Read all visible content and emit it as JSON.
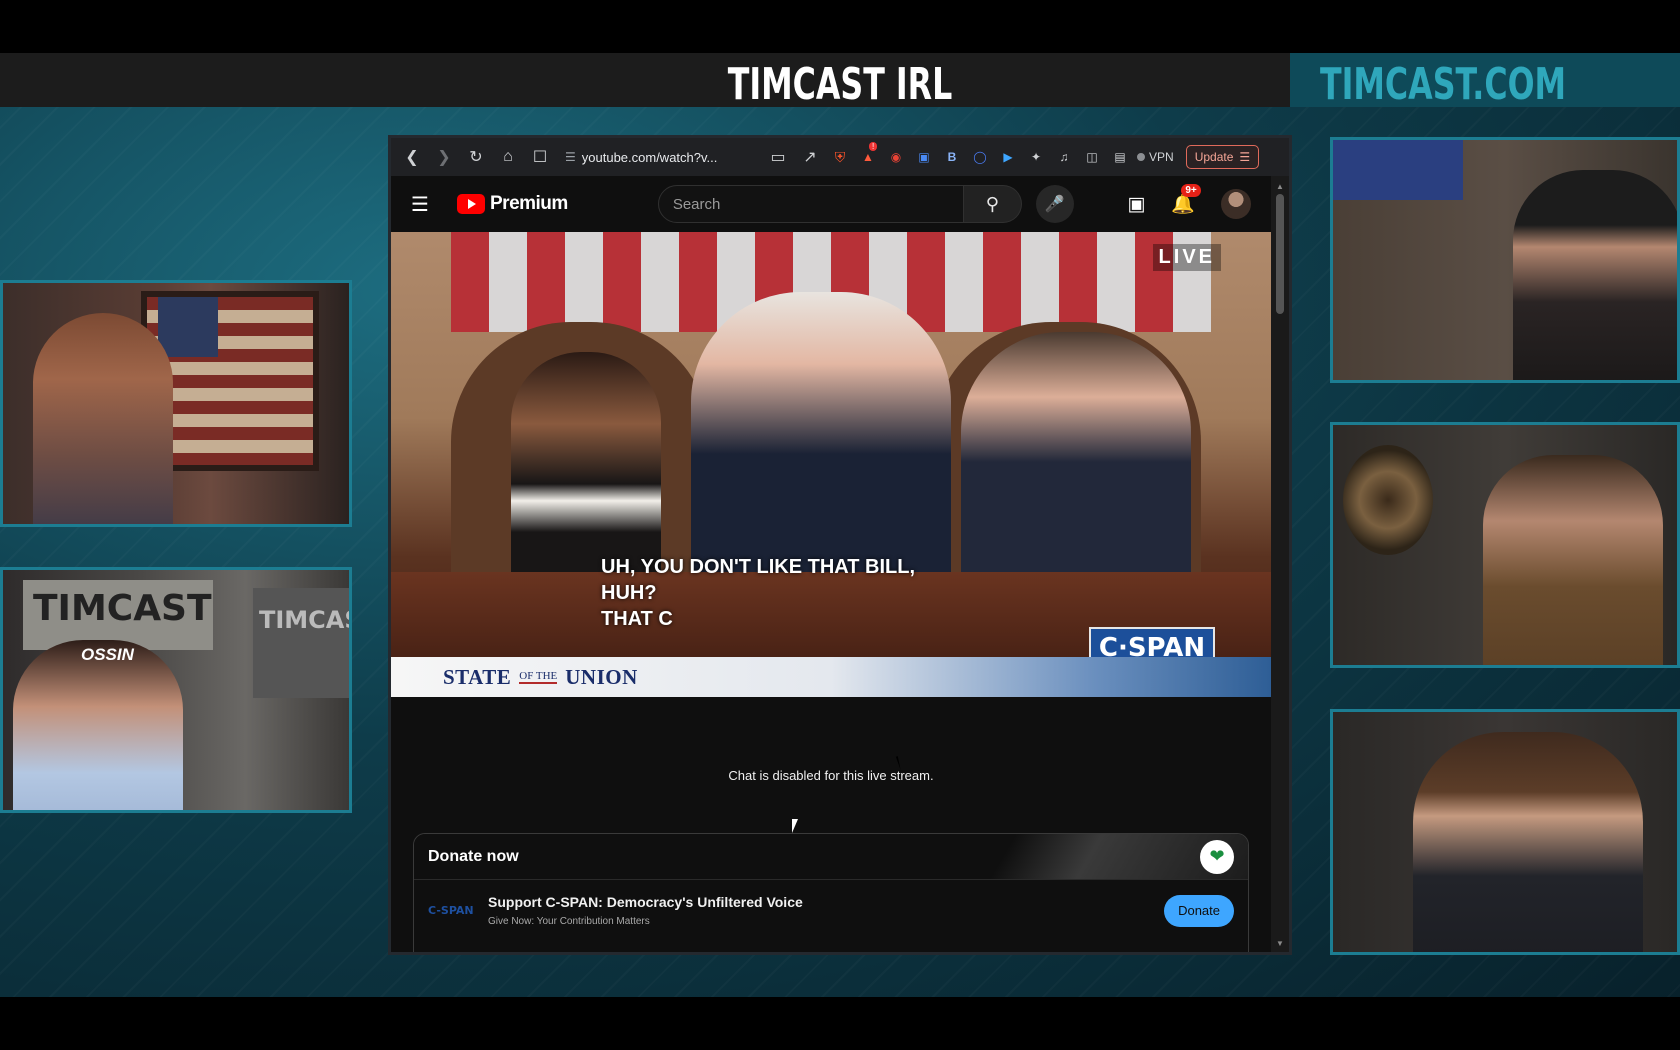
{
  "show": {
    "title": "TIMCAST IRL",
    "website": "TIMCAST.COM"
  },
  "cams": {
    "cam2_sign": "TIMCAST",
    "cam2_sign2": "TIMCAS",
    "cam2_chair_brand": "OSSIN"
  },
  "browser": {
    "url": "youtube.com/watch?v...",
    "vpn_label": "VPN",
    "update_label": "Update",
    "ext_badge": "!"
  },
  "youtube": {
    "logo_text": "Premium",
    "search_placeholder": "Search",
    "notification_count": "9+",
    "live_label": "LIVE",
    "captions": [
      "UH, YOU DON'T LIKE THAT BILL,",
      "HUH?",
      "THAT C"
    ],
    "network_logo": "C·SPAN",
    "lower_third": {
      "left": "STATE",
      "middle": "OF THE",
      "right": "UNION"
    },
    "chat_disabled_text": "Chat is disabled for this live stream.",
    "donate": {
      "header": "Donate now",
      "org_logo": "C-SPAN",
      "org_name": "Support C-SPAN: Democracy's Unfiltered Voice",
      "org_sub": "Give Now: Your Contribution Matters",
      "button": "Donate"
    }
  },
  "colors": {
    "cam_border": "#1c7d92",
    "brand_teal": "#2fa7bb",
    "yt_red": "#ff0000",
    "donate_blue": "#3ea6ff"
  }
}
